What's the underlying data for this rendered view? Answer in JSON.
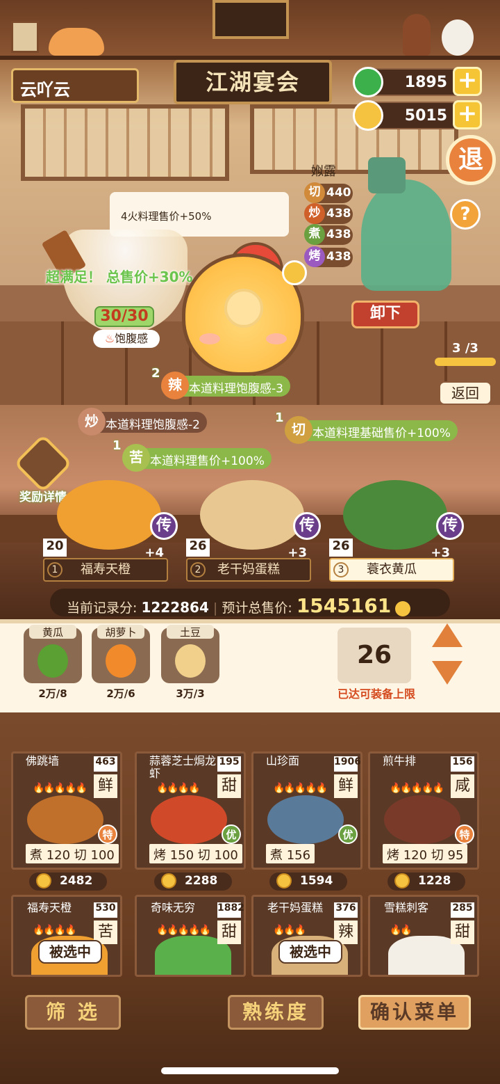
{
  "header": {
    "player_name": "云吖云",
    "title": "江湖宴会",
    "jade": "1895",
    "coins": "5015",
    "exit_label": "退",
    "help_label": "?"
  },
  "npc": {
    "name": "娰露",
    "stats": [
      {
        "icon": "切",
        "value": "440",
        "color": "#d08a3a"
      },
      {
        "icon": "炒",
        "value": "438",
        "color": "#d0602a"
      },
      {
        "icon": "煮",
        "value": "438",
        "color": "#6aa040"
      },
      {
        "icon": "烤",
        "value": "438",
        "color": "#9a5ac0"
      }
    ],
    "unload_label": "卸下"
  },
  "tooltip": "4火料理售价+50%",
  "satisfaction": {
    "banner": "超满足！ 总售价+30%",
    "fullness": "30/30",
    "fullness_label": "饱腹感"
  },
  "pager": {
    "indicator": "3 /3",
    "back_label": "返回"
  },
  "effects": [
    {
      "count": "2",
      "icon": "辣",
      "text": "本道料理饱腹感-3",
      "color": "#8cb84a",
      "badge": "#e8823c"
    },
    {
      "count": "",
      "icon": "炒",
      "text": "本道料理饱腹感-2",
      "color": "#7a4d38",
      "badge": "#c88a6a"
    },
    {
      "count": "1",
      "icon": "切",
      "text": "本道料理基础售价+100%",
      "color": "#8cb84a",
      "badge": "#d0a040"
    },
    {
      "count": "1",
      "icon": "苦",
      "text": "本道料理售价+100%",
      "color": "#8cb84a",
      "badge": "#a8c050"
    }
  ],
  "reward_label": "奖励详情",
  "selected_dishes": [
    {
      "idx": "1",
      "name": "福寿天橙",
      "level": "20",
      "bonus": "+4",
      "tier": "传",
      "selected": false
    },
    {
      "idx": "2",
      "name": "老干妈蛋糕",
      "level": "26",
      "bonus": "+3",
      "tier": "传",
      "selected": false
    },
    {
      "idx": "3",
      "name": "蓑衣黄瓜",
      "level": "26",
      "bonus": "+3",
      "tier": "传",
      "selected": true
    }
  ],
  "score": {
    "current_label": "当前记录分:",
    "current": "1222864",
    "total_label": "预计总售价:",
    "total": "1545161"
  },
  "ingredients": [
    {
      "name": "黄瓜",
      "count": "2万/8",
      "color": "#5aa032"
    },
    {
      "name": "胡萝卜",
      "count": "2万/6",
      "color": "#f08a2a"
    },
    {
      "name": "土豆",
      "count": "3万/3",
      "color": "#f0d08a"
    }
  ],
  "equip": {
    "count": "26",
    "limit_text": "已达可装备上限"
  },
  "menu_cards": [
    {
      "name": "佛跳墙",
      "num": "463",
      "taste": "鲜",
      "fire": "🔥🔥🔥🔥🔥",
      "tier": "特",
      "tier_color": "#e8823c",
      "skills": "煮 120 切 100",
      "price": "2482",
      "pic": "#c0702a"
    },
    {
      "name": "蒜蓉芝士焗龙虾",
      "num": "195",
      "taste": "甜",
      "fire": "🔥🔥🔥🔥",
      "tier": "优",
      "tier_color": "#6aa040",
      "skills": "烤 150 切 100",
      "price": "2288",
      "pic": "#d04a2a"
    },
    {
      "name": "山珍面",
      "num": "1906",
      "taste": "鲜",
      "fire": "🔥🔥🔥🔥🔥",
      "tier": "优",
      "tier_color": "#6aa040",
      "skills": "煮 156",
      "price": "1594",
      "pic": "#5a7a9a"
    },
    {
      "name": "煎牛排",
      "num": "156",
      "taste": "咸",
      "fire": "🔥🔥🔥🔥🔥",
      "tier": "特",
      "tier_color": "#e8823c",
      "skills": "烤 120 切 95",
      "price": "1228",
      "pic": "#7a3a2a"
    }
  ],
  "menu_cards_row2": [
    {
      "name": "福寿天橙",
      "num": "530",
      "taste": "苦",
      "fire": "🔥🔥🔥🔥",
      "selected_label": "被选中",
      "pic": "#f0a030"
    },
    {
      "name": "奇味无穷",
      "num": "1882",
      "taste": "甜",
      "fire": "🔥🔥🔥🔥🔥",
      "selected_label": "",
      "pic": "#5ab04a"
    },
    {
      "name": "老干妈蛋糕",
      "num": "376",
      "taste": "辣",
      "fire": "🔥🔥🔥",
      "selected_label": "被选中",
      "pic": "#d8b07a"
    },
    {
      "name": "雪糕刺客",
      "num": "285",
      "taste": "甜",
      "fire": "🔥🔥",
      "selected_label": "",
      "pic": "#f4efe6"
    }
  ],
  "footer": {
    "filter": "筛 选",
    "proficiency": "熟练度",
    "confirm": "确认菜单"
  },
  "colors": {
    "accent": "#f5c536",
    "primary_red": "#c2402e",
    "wood": "#5a3a26"
  }
}
